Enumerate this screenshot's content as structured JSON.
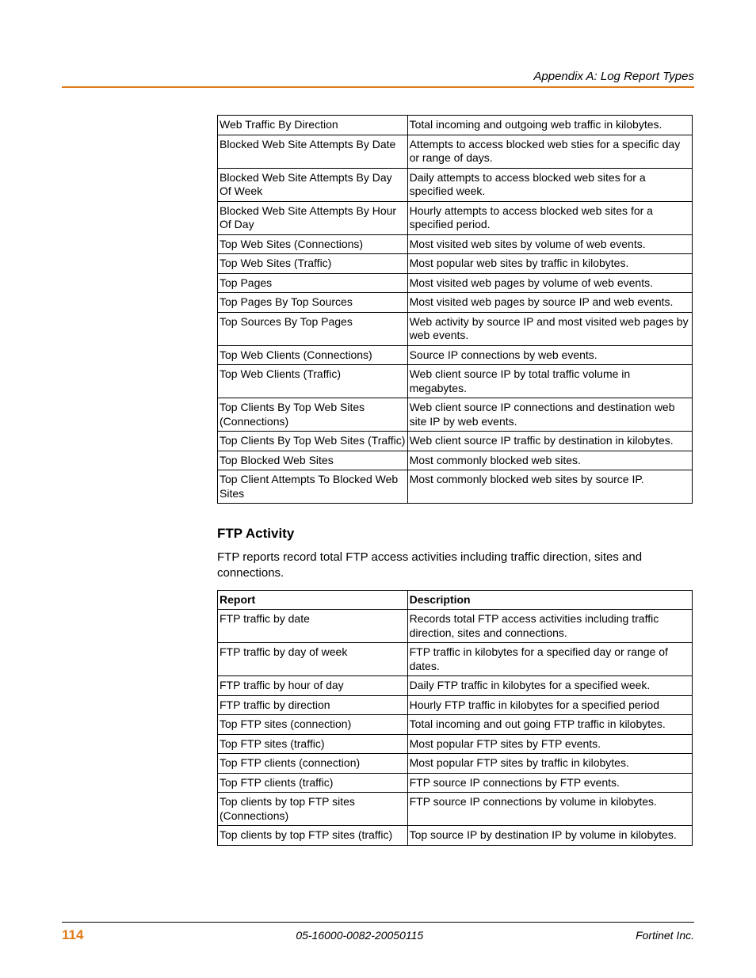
{
  "header": {
    "title": "Appendix A: Log Report Types"
  },
  "table1": {
    "rows": [
      {
        "report": "Web Traffic By Direction",
        "desc": "Total incoming and outgoing web traffic in kilobytes."
      },
      {
        "report": "Blocked Web Site Attempts By Date",
        "desc": "Attempts to access blocked web sties for a specific day or range of days."
      },
      {
        "report": "Blocked Web Site Attempts By Day Of Week",
        "desc": "Daily attempts to access blocked web sites for a specified week."
      },
      {
        "report": "Blocked Web Site Attempts By Hour Of Day",
        "desc": "Hourly attempts to access blocked web sites for a specified period."
      },
      {
        "report": "Top Web Sites (Connections)",
        "desc": "Most visited web sites by volume of web events."
      },
      {
        "report": "Top Web Sites (Traffic)",
        "desc": "Most popular web sites by traffic in kilobytes."
      },
      {
        "report": "Top Pages",
        "desc": "Most visited web pages by volume of web events."
      },
      {
        "report": "Top Pages By Top Sources",
        "desc": "Most visited web pages by source IP and web events."
      },
      {
        "report": "Top Sources By Top Pages",
        "desc": "Web activity by source IP and most visited web pages by web events."
      },
      {
        "report": "Top Web Clients (Connections)",
        "desc": "Source IP connections by web events."
      },
      {
        "report": "Top Web Clients (Traffic)",
        "desc": "Web client source IP by total traffic volume in megabytes."
      },
      {
        "report": "Top Clients By Top Web Sites (Connections)",
        "desc": "Web client source IP connections and destination web site IP by web events."
      },
      {
        "report": "Top Clients By Top Web Sites (Traffic)",
        "desc": "Web client source IP traffic by destination in kilobytes."
      },
      {
        "report": "Top Blocked Web Sites",
        "desc": "Most commonly blocked web sites."
      },
      {
        "report": "Top Client Attempts To Blocked Web Sites",
        "desc": "Most commonly blocked web sites by source IP."
      }
    ]
  },
  "section2": {
    "heading": "FTP Activity",
    "intro": "FTP reports record total FTP access activities including traffic direction, sites and connections.",
    "header_report": "Report",
    "header_desc": "Description",
    "rows": [
      {
        "report": "FTP traffic by date",
        "desc": "Records total FTP access activities including traffic direction, sites and connections."
      },
      {
        "report": "FTP traffic by day of week",
        "desc": "FTP traffic in kilobytes for a specified day or range of dates."
      },
      {
        "report": "FTP traffic by hour of day",
        "desc": "Daily FTP traffic in kilobytes for a specified week."
      },
      {
        "report": "FTP traffic by direction",
        "desc": "Hourly FTP traffic in kilobytes for a specified period"
      },
      {
        "report": "Top FTP sites (connection)",
        "desc": "Total incoming and out going FTP traffic in kilobytes."
      },
      {
        "report": "Top FTP sites (traffic)",
        "desc": "Most popular FTP sites by FTP events."
      },
      {
        "report": "Top FTP clients (connection)",
        "desc": "Most popular FTP sites by traffic in kilobytes."
      },
      {
        "report": "Top FTP clients (traffic)",
        "desc": "FTP source IP connections by FTP events."
      },
      {
        "report": "Top clients by top FTP sites (Connections)",
        "desc": "FTP source IP connections by volume in kilobytes."
      },
      {
        "report": "Top clients by top FTP sites (traffic)",
        "desc": "Top source IP by destination IP by volume in kilobytes."
      }
    ]
  },
  "footer": {
    "page": "114",
    "center": "05-16000-0082-20050115",
    "right": "Fortinet Inc."
  }
}
